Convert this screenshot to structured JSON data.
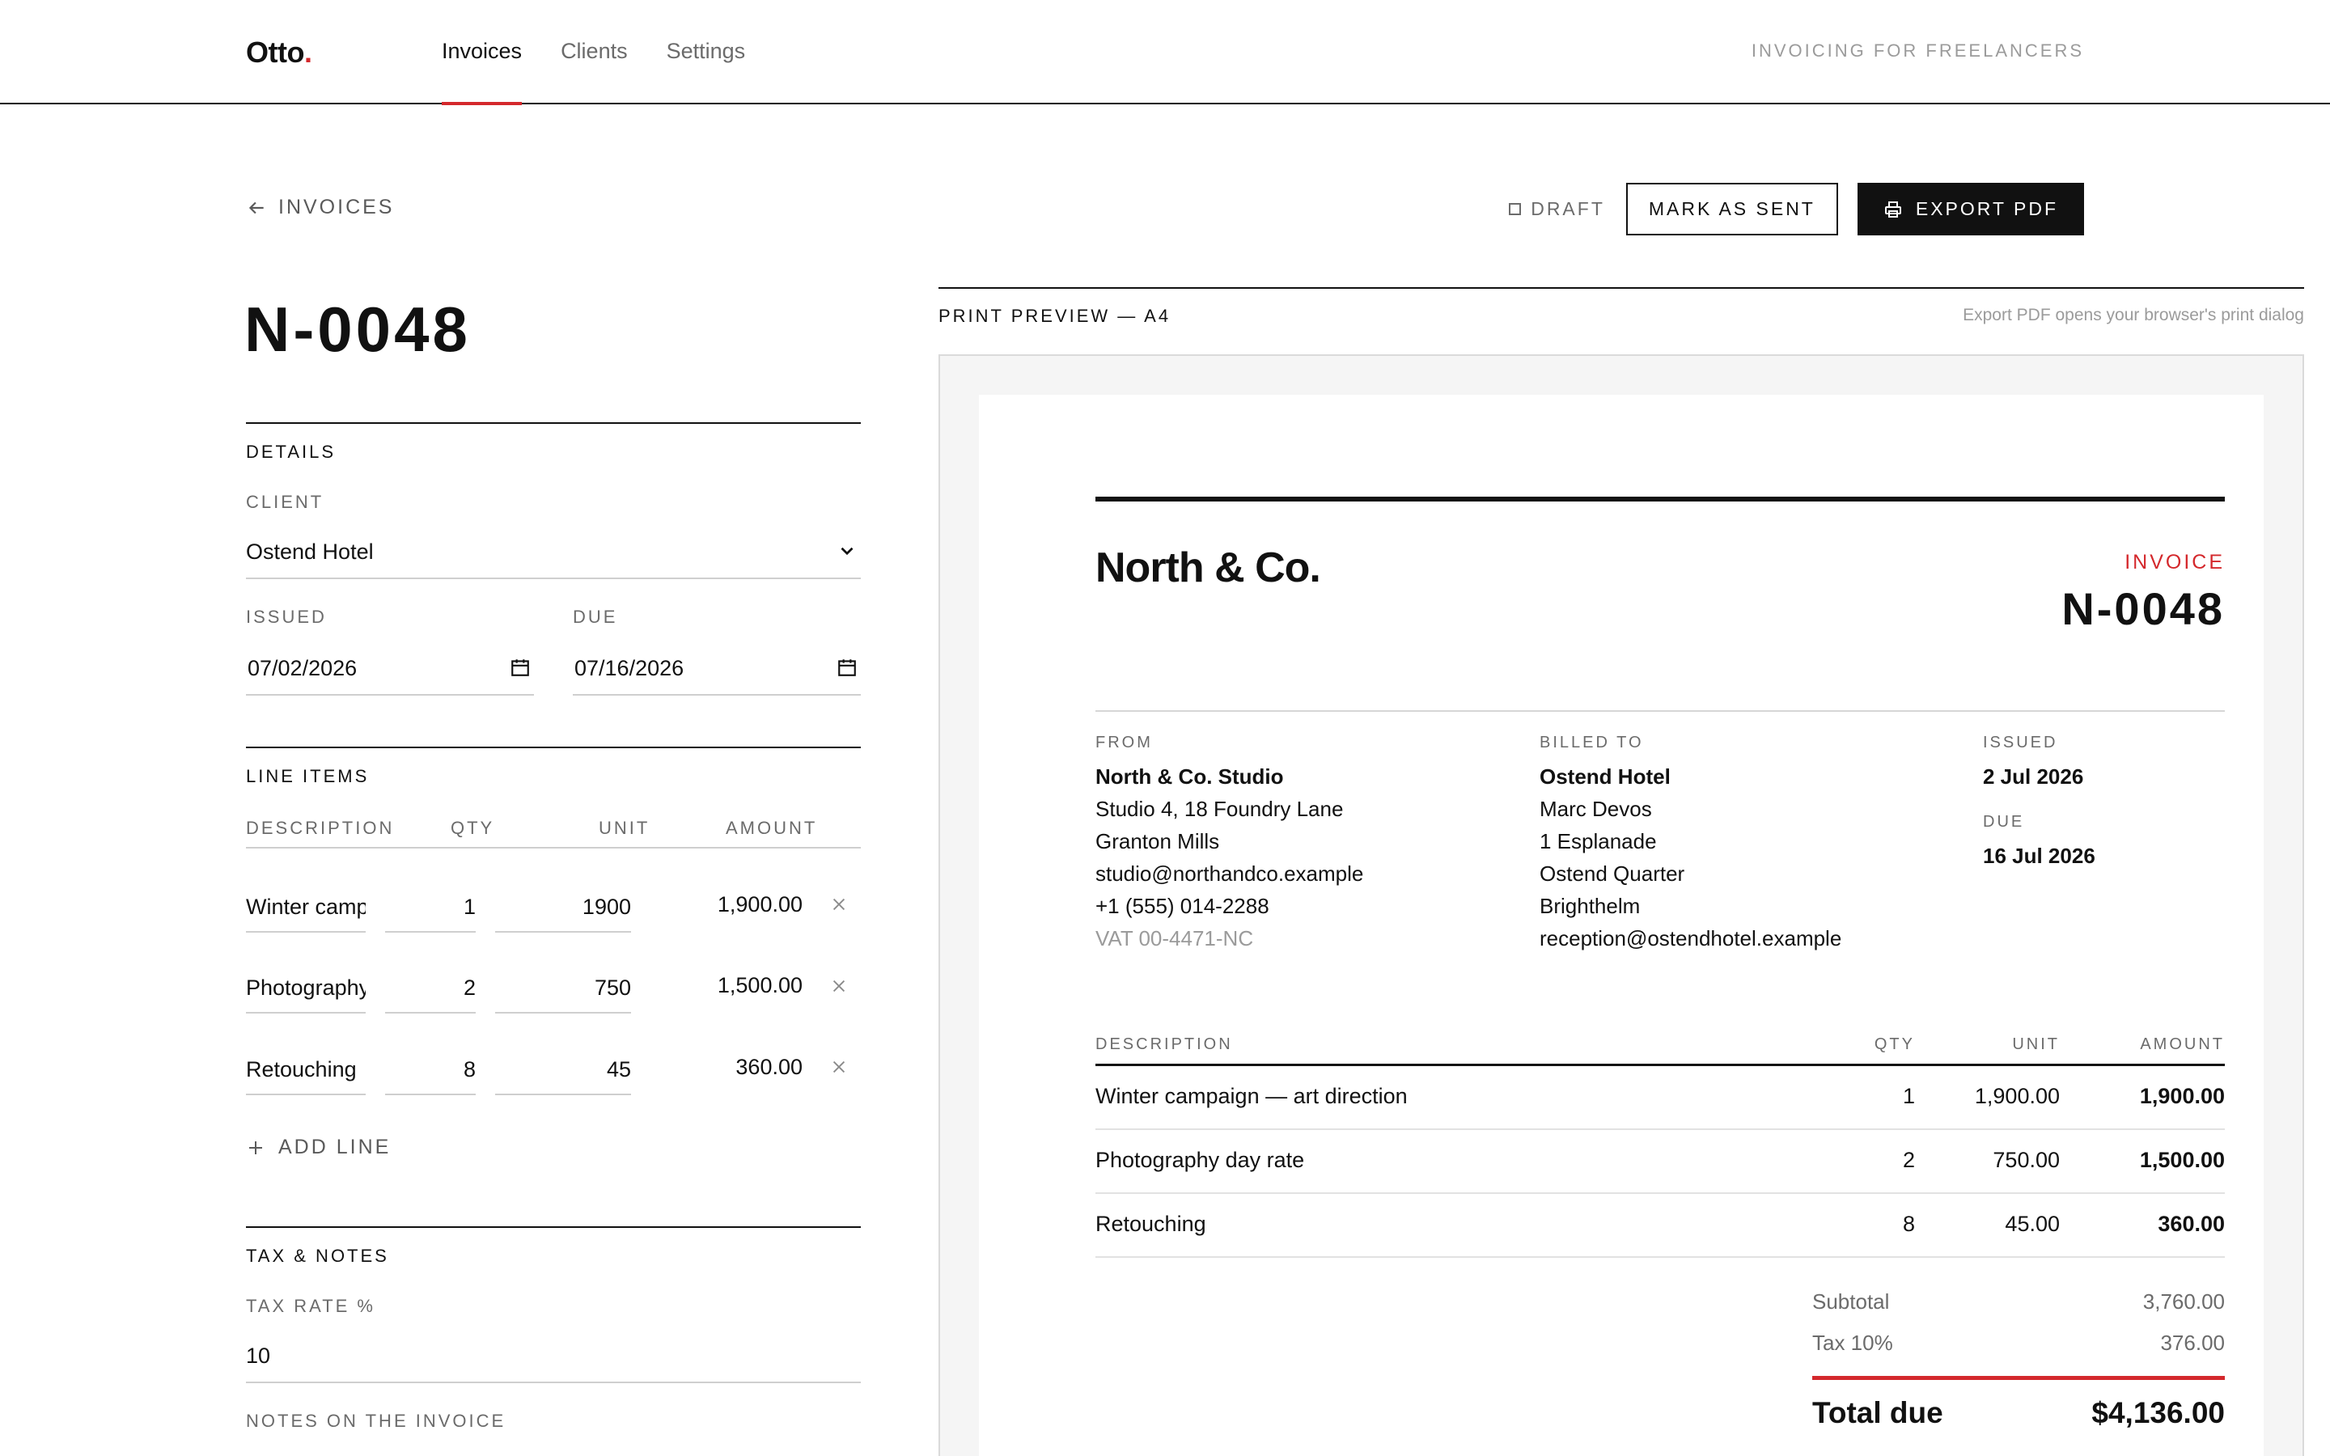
{
  "header": {
    "brand": "Otto",
    "brand_dot": ".",
    "nav": [
      {
        "label": "Invoices",
        "active": true
      },
      {
        "label": "Clients",
        "active": false
      },
      {
        "label": "Settings",
        "active": false
      }
    ],
    "tagline": "INVOICING FOR FREELANCERS"
  },
  "toolbar": {
    "back_label": "INVOICES",
    "status": "DRAFT",
    "mark_sent": "MARK AS SENT",
    "export_pdf": "EXPORT PDF"
  },
  "editor": {
    "invoice_number": "N-0048",
    "details": {
      "heading": "DETAILS",
      "client_label": "CLIENT",
      "client_value": "Ostend Hotel",
      "issued_label": "ISSUED",
      "issued_value": "07/02/2026",
      "due_label": "DUE",
      "due_value": "07/16/2026"
    },
    "line_items": {
      "heading": "LINE ITEMS",
      "columns": {
        "description": "DESCRIPTION",
        "qty": "QTY",
        "unit": "UNIT",
        "amount": "AMOUNT"
      },
      "rows": [
        {
          "description": "Winter campaign — art direction",
          "qty": "1",
          "unit": "1900",
          "amount": "1,900.00"
        },
        {
          "description": "Photography day rate",
          "qty": "2",
          "unit": "750",
          "amount": "1,500.00"
        },
        {
          "description": "Retouching",
          "qty": "8",
          "unit": "45",
          "amount": "360.00"
        }
      ],
      "add_line": "ADD LINE"
    },
    "tax_notes": {
      "heading": "TAX & NOTES",
      "tax_label": "TAX RATE %",
      "tax_value": "10",
      "notes_label": "NOTES ON THE INVOICE"
    }
  },
  "preview": {
    "label": "PRINT PREVIEW — A4",
    "hint": "Export PDF opens your browser's print dialog",
    "company": "North & Co.",
    "invoice_label": "INVOICE",
    "invoice_number": "N-0048",
    "from": {
      "heading": "FROM",
      "name": "North & Co. Studio",
      "lines": [
        "Studio 4, 18 Foundry Lane",
        "Granton Mills",
        "studio@northandco.example",
        "+1 (555) 014-2288"
      ],
      "vat": "VAT 00-4471-NC"
    },
    "billed_to": {
      "heading": "BILLED TO",
      "name": "Ostend Hotel",
      "lines": [
        "Marc Devos",
        "1 Esplanade",
        "Ostend Quarter",
        "Brighthelm",
        "reception@ostendhotel.example"
      ]
    },
    "dates": {
      "issued_label": "ISSUED",
      "issued": "2 Jul 2026",
      "due_label": "DUE",
      "due": "16 Jul 2026"
    },
    "table": {
      "columns": {
        "description": "DESCRIPTION",
        "qty": "QTY",
        "unit": "UNIT",
        "amount": "AMOUNT"
      },
      "rows": [
        {
          "description": "Winter campaign — art direction",
          "qty": "1",
          "unit": "1,900.00",
          "amount": "1,900.00"
        },
        {
          "description": "Photography day rate",
          "qty": "2",
          "unit": "750.00",
          "amount": "1,500.00"
        },
        {
          "description": "Retouching",
          "qty": "8",
          "unit": "45.00",
          "amount": "360.00"
        }
      ]
    },
    "totals": {
      "subtotal_label": "Subtotal",
      "subtotal": "3,760.00",
      "tax_label": "Tax 10%",
      "tax": "376.00",
      "total_label": "Total due",
      "total": "$4,136.00"
    }
  },
  "colors": {
    "accent": "#d4282c",
    "ink": "#111111",
    "muted": "#6b6b6b"
  }
}
